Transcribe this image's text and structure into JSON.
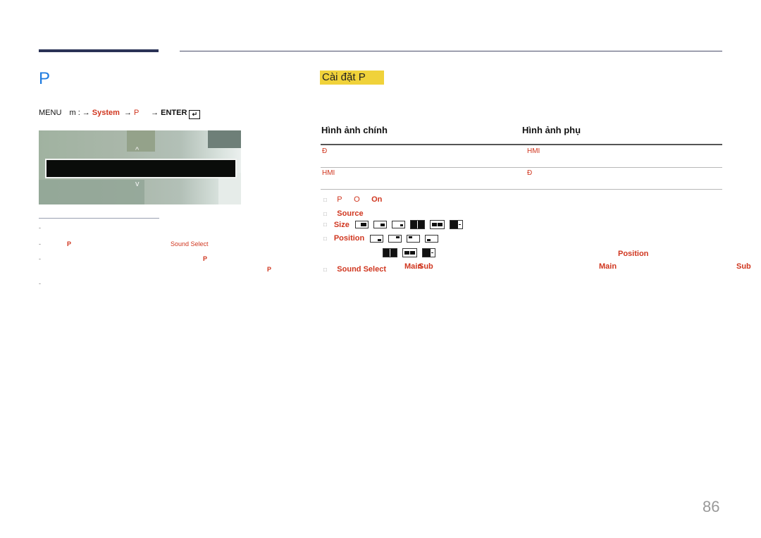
{
  "page": {
    "title": "P",
    "page_number": "86"
  },
  "menu_path": {
    "menu_label": "MENU",
    "menu_icon": "m-menu-icon-glyph",
    "menu_glyph": "m",
    "sep": ":",
    "arrow": "→",
    "system": "System",
    "item": "P",
    "enter": "ENTER",
    "enter_icon_glyph": "↵"
  },
  "osd": {
    "up_glyph": "^",
    "down_glyph": "v",
    "selected_text": ""
  },
  "notes": {
    "dash": "-",
    "note2_red1": "P",
    "note2_red2": "Sound Select",
    "note3_red1": "P",
    "note3_red2": "P"
  },
  "section": {
    "tag_label": "Cài đặt P"
  },
  "table": {
    "headers": [
      "Hình ảnh chính",
      "Hình ảnh phụ"
    ],
    "rows": [
      [
        "Đ",
        "HMI"
      ],
      [
        "HMI",
        "Đ"
      ]
    ]
  },
  "options": {
    "bullet": "□",
    "pip_on": {
      "p": "P",
      "o": "O",
      "value": "On"
    },
    "source": {
      "label": "Source"
    },
    "size": {
      "label": "Size",
      "icons": [
        "size-large-br",
        "size-medium-br",
        "size-small-br",
        "split-equal",
        "split-wide",
        "split-main-sub"
      ]
    },
    "position": {
      "label": "Position",
      "icons": [
        "pos-bottom-right",
        "pos-top-right",
        "pos-top-left",
        "pos-bottom-left"
      ],
      "note_icons": [
        "split-equal",
        "split-wide",
        "split-main-sub"
      ],
      "note_red": "Position"
    },
    "sound_select": {
      "label": "Sound Select",
      "main": "Main",
      "sub": "Sub",
      "desc_main": "Main",
      "desc_sub": "Sub"
    }
  }
}
